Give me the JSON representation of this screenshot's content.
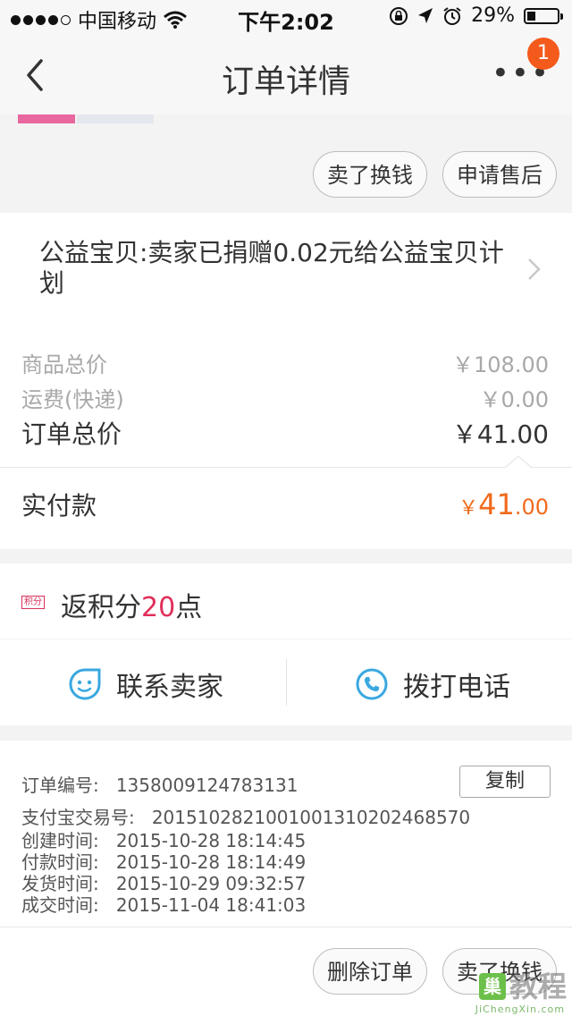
{
  "status_bar": {
    "carrier": "中国移动",
    "time": "下午2:02",
    "battery": "29%"
  },
  "nav": {
    "title": "订单详情",
    "badge_count": "1",
    "more": "•••"
  },
  "actions_top": {
    "sell_button": "卖了换钱",
    "after_sale_button": "申请售后"
  },
  "charity": {
    "text": "公益宝贝:卖家已捐赠0.02元给公益宝贝计划"
  },
  "summary": {
    "goods_label": "商品总价",
    "goods_value": "￥108.00",
    "shipping_label": "运费(快递)",
    "shipping_value": "￥0.00",
    "order_total_label": "订单总价",
    "order_total_value": "￥41.00",
    "paid_label": "实付款",
    "paid_currency": "￥",
    "paid_int": "41",
    "paid_dec": ".00"
  },
  "points": {
    "tag": "积分",
    "prefix": "返积分",
    "value": "20",
    "suffix": "点"
  },
  "contact": {
    "seller": "联系卖家",
    "call": "拨打电话"
  },
  "order_info": {
    "order_no_label": "订单编号:",
    "order_no": "1358009124783131",
    "copy_button": "复制",
    "alipay_label": "支付宝交易号:",
    "alipay_no": "2015102821001001310202468570",
    "created_label": "创建时间:",
    "created": "2015-10-28 18:14:45",
    "paid_label": "付款时间:",
    "paid": "2015-10-28 18:14:49",
    "shipped_label": "发货时间:",
    "shipped": "2015-10-29 09:32:57",
    "completed_label": "成交时间:",
    "completed": "2015-11-04 18:41:03"
  },
  "actions_bottom": {
    "delete_button": "删除订单",
    "sell_button": "卖了换钱"
  },
  "watermark": {
    "logo": "巢",
    "text": "教程",
    "url": "JiChengXin.com"
  },
  "colors": {
    "accent_orange": "#f06a1a",
    "points_pink": "#e02f5a",
    "icon_blue": "#3aa8e0",
    "badge": "#f45a1c"
  }
}
